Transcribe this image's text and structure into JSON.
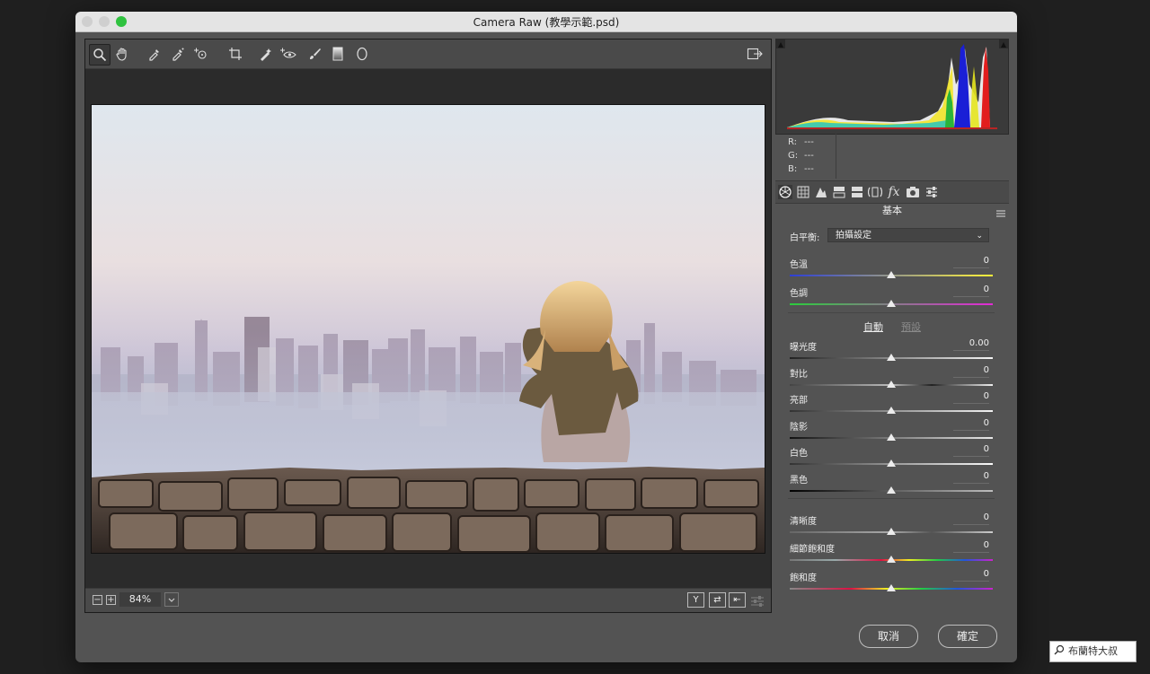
{
  "window": {
    "title": "Camera Raw (教學示範.psd)"
  },
  "toolbar": {
    "tools": [
      "zoom-icon",
      "hand-icon",
      "white-balance-icon",
      "color-sampler-icon",
      "target-adjust-icon",
      "crop-icon",
      "spot-removal-icon",
      "red-eye-icon",
      "adjustment-brush-icon",
      "graduated-filter-icon",
      "radial-filter-icon"
    ],
    "export_icon": "open-preferences-icon"
  },
  "bottom": {
    "zoom_out": "−",
    "zoom_in": "+",
    "zoom": "84%",
    "view_y": "Y",
    "view_swap": "⇄",
    "view_copy": "⇤"
  },
  "histogram": {
    "r_label": "R:",
    "g_label": "G:",
    "b_label": "B:",
    "r_value": "---",
    "g_value": "---",
    "b_value": "---"
  },
  "panel": {
    "title": "基本",
    "white_balance": {
      "label": "白平衡:",
      "value": "拍攝設定"
    },
    "auto_label": "自動",
    "default_label": "預設",
    "sliders": [
      {
        "label": "色溫",
        "value": "0",
        "level": 0.5
      },
      {
        "label": "色調",
        "value": "0",
        "level": 0.5
      },
      {
        "label": "曝光度",
        "value": "0.00",
        "level": 0.5
      },
      {
        "label": "對比",
        "value": "0",
        "level": 0.5
      },
      {
        "label": "亮部",
        "value": "0",
        "level": 0.5
      },
      {
        "label": "陰影",
        "value": "0",
        "level": 0.5
      },
      {
        "label": "白色",
        "value": "0",
        "level": 0.5
      },
      {
        "label": "黑色",
        "value": "0",
        "level": 0.5
      },
      {
        "label": "清晰度",
        "value": "0",
        "level": 0.5
      },
      {
        "label": "細節飽和度",
        "value": "0",
        "level": 0.5
      },
      {
        "label": "飽和度",
        "value": "0",
        "level": 0.5
      }
    ]
  },
  "buttons": {
    "cancel": "取消",
    "ok": "確定"
  },
  "watermark": "布蘭特大叔"
}
